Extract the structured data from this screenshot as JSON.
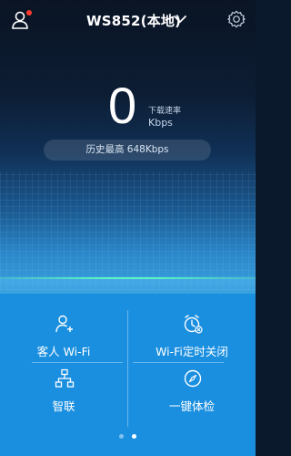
{
  "header": {
    "title": "WS852(本地)",
    "icons": [
      "user-icon",
      "chevron-down-icon",
      "gear-icon"
    ],
    "notification_dot_color": "#ff3b30"
  },
  "speed": {
    "value": "0",
    "label": "下载速率",
    "unit": "Kbps"
  },
  "history": {
    "text": "历史最高 648Kbps"
  },
  "actions": [
    {
      "label": "客人 Wi-Fi",
      "icon": "guest-user-icon"
    },
    {
      "label": "Wi-Fi定时关闭",
      "icon": "wifi-timer-icon"
    },
    {
      "label": "智联",
      "icon": "network-topology-icon"
    },
    {
      "label": "一键体检",
      "icon": "compass-icon"
    }
  ],
  "pager": {
    "count": 2,
    "active": 2
  },
  "colors": {
    "panel": "#1a8fe0",
    "accent_line": "#5af5c0",
    "text": "#ffffff"
  }
}
